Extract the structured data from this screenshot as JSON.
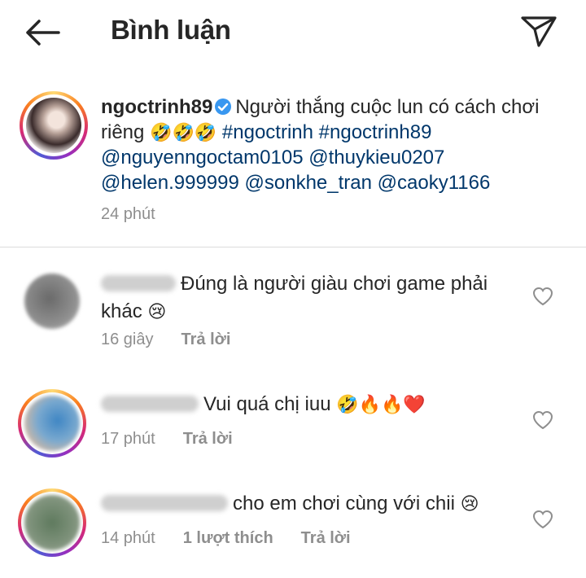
{
  "header": {
    "title": "Bình luận"
  },
  "caption": {
    "username": "ngoctrinh89",
    "text": "Người thắng cuộc lun có cách chơi riêng ",
    "emojis": "🤣🤣🤣",
    "hashtags": " #ngoctrinh #ngoctrinh89",
    "mentions": "@nguyenngoctam0105 @thuykieu0207 @helen.999999 @sonkhe_tran @caoky1166",
    "time": "24 phút"
  },
  "comments": [
    {
      "text": "Đúng là người giàu chơi game phải khác ",
      "emoji": "😢",
      "time": "16 giây",
      "likes": "",
      "reply": "Trả lời"
    },
    {
      "text": "Vui quá chị iuu ",
      "emoji": "🤣🔥🔥❤️",
      "time": "17 phút",
      "likes": "",
      "reply": "Trả lời"
    },
    {
      "text": "cho em chơi cùng với chii ",
      "emoji": "😢",
      "time": "14 phút",
      "likes": "1 lượt thích",
      "reply": "Trả lời"
    }
  ],
  "colors": {
    "text": "#262626",
    "secondary": "#8e8e8e",
    "link": "#00376b",
    "verified": "#3897f0"
  },
  "icons": [
    "back-arrow-icon",
    "send-icon",
    "verified-badge-icon",
    "heart-icon"
  ]
}
